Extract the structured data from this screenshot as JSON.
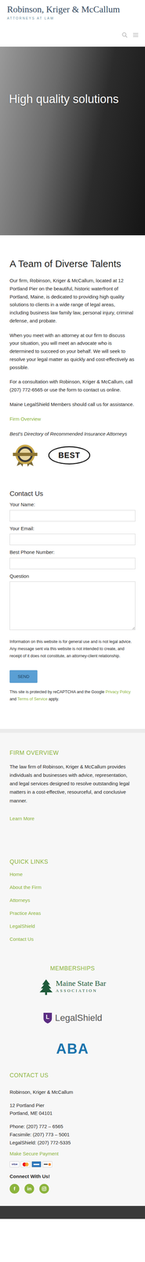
{
  "header": {
    "logo_title": "Robinson, Kriger & McCallum",
    "logo_subtitle": "ATTORNEYS AT LAW"
  },
  "hero": {
    "title": "High quality solutions"
  },
  "intro": {
    "heading": "A Team of Diverse Talents",
    "paragraphs": [
      "Our firm, Robinson, Kriger & McCallum, located at 12 Portland Pier on the beautiful, historic waterfront of Portland, Maine, is dedicated to providing high quality solutions to clients in a wide range of legal areas, including business law family law, personal injury, criminal defense, and probate.",
      "When you meet with an attorney at our firm to discuss your situation, you will meet an advocate who is determined to succeed on your behalf. We will seek to resolve your legal matter as quickly and cost-effectively as possible.",
      "For a consultation with Robinson, Kriger & McCallum, call (207) 772-6565 or use the form to contact us online.",
      "Maine LegalShield Members should call us for assistance."
    ],
    "link": "Firm Overview",
    "directory": "Best's Directory of Recommended Insurance Attorneys",
    "badges": [
      {
        "kind": "seal"
      },
      {
        "kind": "best",
        "title": "BEST"
      }
    ]
  },
  "contact_form": {
    "heading": "Contact Us",
    "fields": [
      {
        "label": "Your Name:",
        "kind": "input"
      },
      {
        "label": "Your Email:",
        "kind": "input"
      },
      {
        "label": "Best Phone Number:",
        "kind": "input"
      },
      {
        "label": "Question",
        "kind": "textarea"
      }
    ],
    "disclaimer": "Information on this website is for general use and is not legal advice. Any message sent via this website is not intended to create, and receipt of it does not constitute, an attorney-client relationship.",
    "button": "SEND",
    "recaptcha": {
      "before": "This site is protected by reCAPTCHA and the Google ",
      "privacy": "Privacy Policy",
      "and": " and ",
      "terms": "Terms of Service",
      "after": " apply."
    }
  },
  "footer": {
    "overview": {
      "heading": "FIRM OVERVIEW",
      "text": "The law firm of Robinson, Kriger & McCallum provides individuals and businesses with advice, representation, and legal services designed to resolve outstanding legal matters in a cost-effective, resourceful, and conclusive manner.",
      "link": "Learn More"
    },
    "quick_links": {
      "heading": "QUICK LINKS",
      "items": [
        "Home",
        "About the Firm",
        "Attorneys",
        "Practice Areas",
        "LegalShield",
        "Contact Us"
      ]
    },
    "memberships": {
      "heading": "MEMBERSHIPS",
      "logos": [
        {
          "kind": "msba",
          "title": "Maine State Bar",
          "subtitle": "ASSOCIATION"
        },
        {
          "kind": "legalshield",
          "mark": "L",
          "title": "LegalShield"
        },
        {
          "kind": "aba",
          "title": "ABA"
        }
      ]
    },
    "contact": {
      "heading": "CONTACT US",
      "name": "Robinson, Kriger & McCallum",
      "address": [
        "12 Portland Pier",
        "Portland, ME 04101"
      ],
      "phones": [
        "Phone: (207) 772 – 6565",
        "Facsimile: (207) 773 – 5001",
        "LegalShield: (207) 772-5335"
      ],
      "payment": "Make Secure Payment",
      "cards": [
        {
          "kind": "visa",
          "label": "VISA"
        },
        {
          "kind": "mastercard"
        },
        {
          "kind": "amex"
        },
        {
          "kind": "discover"
        }
      ],
      "connect": "Connect With Us!",
      "social": [
        {
          "kind": "facebook",
          "label": "f"
        },
        {
          "kind": "linkedin",
          "label": "in"
        },
        {
          "kind": "instagram"
        }
      ]
    }
  }
}
